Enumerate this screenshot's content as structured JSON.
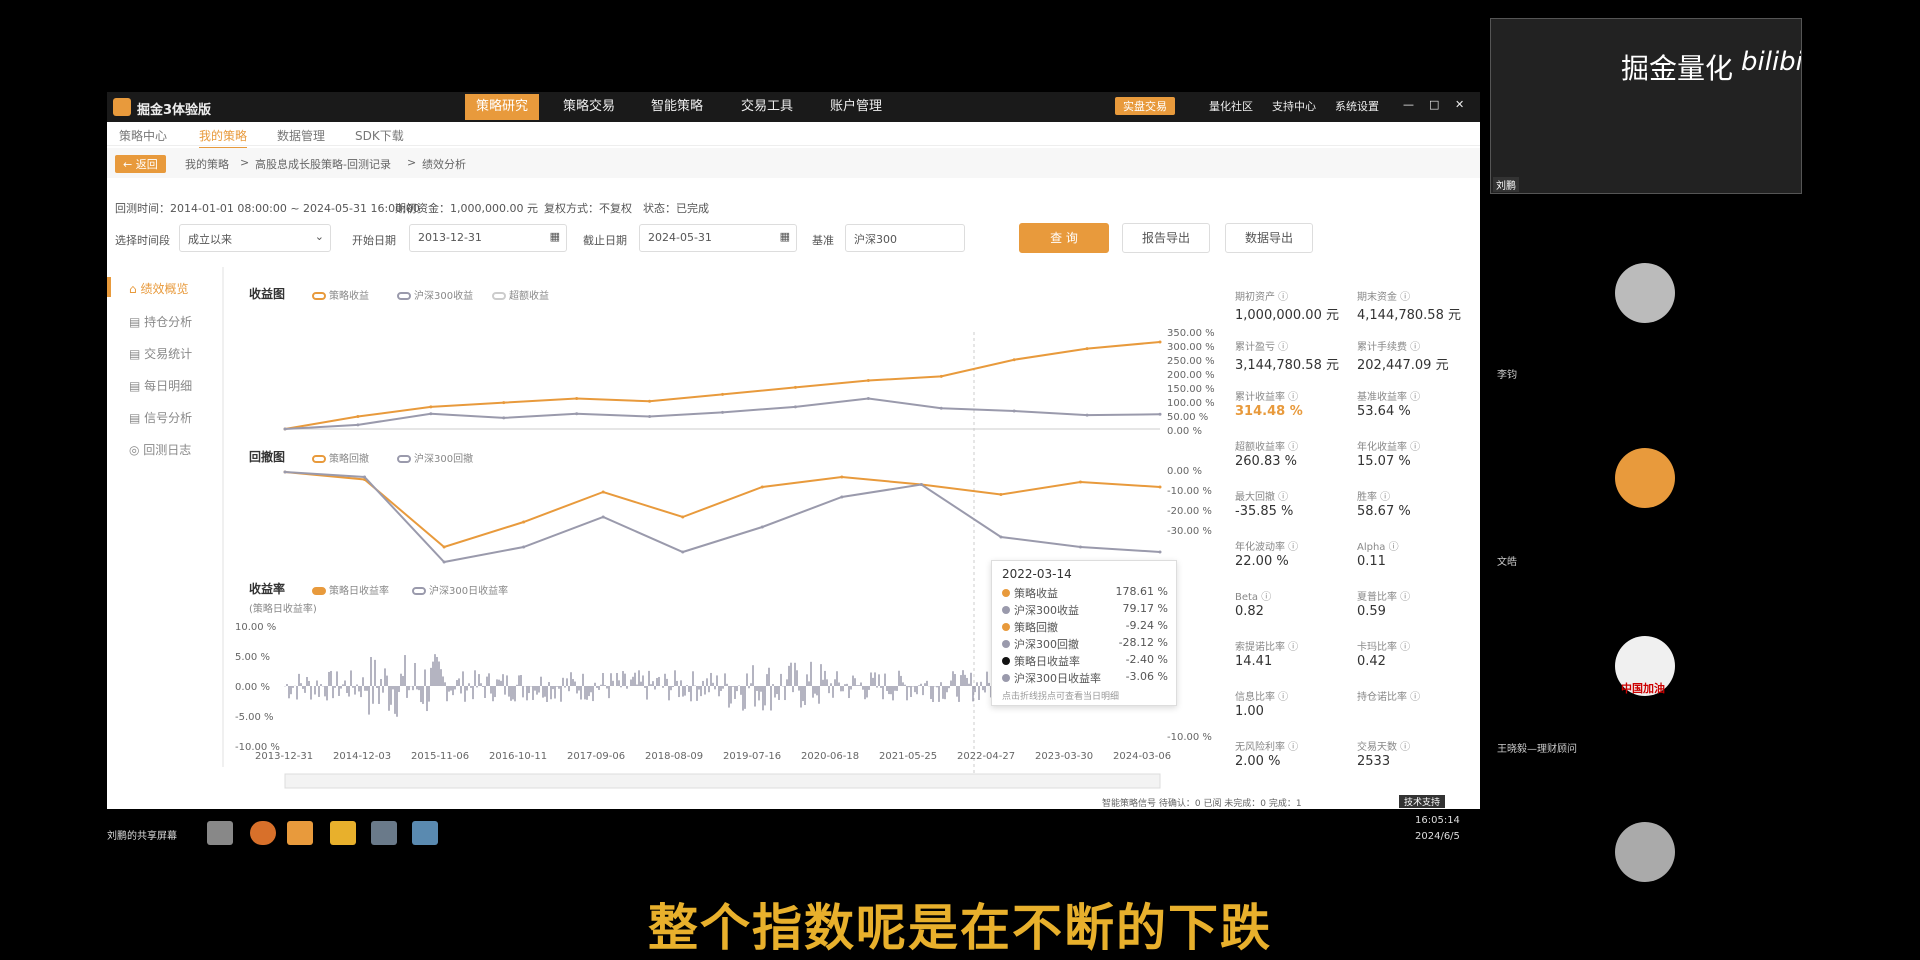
{
  "app": {
    "title": "掘金3体验版",
    "nav": [
      "策略研究",
      "策略交易",
      "智能策略",
      "交易工具",
      "账户管理"
    ],
    "nav_active_index": 0,
    "right_nav": [
      "实盘交易",
      "量化社区",
      "支持中心",
      "系统设置"
    ],
    "window_controls": [
      "—",
      "□",
      "✕"
    ]
  },
  "subnav": [
    "策略中心",
    "我的策略",
    "数据管理",
    "SDK下载"
  ],
  "breadcrumb": {
    "back": "← 返回",
    "items": [
      "我的策略",
      ">",
      "高股息成长股策略-回测记录",
      ">",
      "绩效分析"
    ]
  },
  "info": {
    "period": "回测时间：2014-01-01 08:00:00 ~ 2024-05-31 16:00:00",
    "capital": "期初资金：1,000,000.00 元",
    "adjust": "复权方式：不复权",
    "state": "状态：已完成"
  },
  "filters": {
    "range_label": "选择时间段",
    "range_value": "成立以来",
    "start_label": "开始日期",
    "start_value": "2013-12-31",
    "end_label": "截止日期",
    "end_value": "2024-05-31",
    "bench_label": "基准",
    "bench_value": "沪深300",
    "query": "查 询",
    "report": "报告导出",
    "data": "数据导出"
  },
  "sidebar": [
    "绩效概览",
    "持仓分析",
    "交易统计",
    "每日明细",
    "信号分析",
    "回测日志"
  ],
  "charts": {
    "returns_title": "收益图",
    "returns_legend": [
      "策略收益",
      "沪深300收益",
      "超额收益"
    ],
    "drawdown_title": "回撤图",
    "drawdown_legend": [
      "策略回撤",
      "沪深300回撤"
    ],
    "daily_title": "收益率",
    "daily_sub": "(策略日收益率)",
    "daily_legend": [
      "策略日收益率",
      "沪深300日收益率"
    ],
    "right_ticks_returns": [
      "350.00 %",
      "300.00 %",
      "250.00 %",
      "200.00 %",
      "150.00 %",
      "100.00 %",
      "50.00 %",
      "0.00 %"
    ],
    "right_ticks_dd": [
      "0.00 %",
      "-10.00 %",
      "-20.00 %",
      "-30.00 %"
    ],
    "right_ticks_daily": [
      "-10.00 %"
    ],
    "left_ticks_daily": [
      "10.00 %",
      "5.00 %",
      "0.00 %",
      "-5.00 %",
      "-10.00 %"
    ],
    "x_ticks": [
      "2013-12-31",
      "2014-12-03",
      "2015-11-06",
      "2016-10-11",
      "2017-09-06",
      "2018-08-09",
      "2019-07-16",
      "2020-06-18",
      "2021-05-25",
      "2022-04-27",
      "2023-03-30",
      "2024-03-06"
    ]
  },
  "chart_data": [
    {
      "type": "line",
      "title": "收益图",
      "x": [
        "2013-12-31",
        "2014-12-03",
        "2015-11-06",
        "2016-10-11",
        "2017-09-06",
        "2018-08-09",
        "2019-07-16",
        "2020-06-18",
        "2021-05-25",
        "2022-04-27",
        "2023-03-30",
        "2024-03-06",
        "2024-05-31"
      ],
      "series": [
        {
          "name": "策略收益",
          "color": "#e89a3c",
          "values": [
            0,
            45,
            80,
            95,
            110,
            100,
            125,
            150,
            175,
            190,
            250,
            290,
            314
          ]
        },
        {
          "name": "沪深300收益",
          "color": "#9a9aac",
          "values": [
            0,
            15,
            55,
            40,
            55,
            45,
            60,
            80,
            110,
            75,
            65,
            50,
            53
          ]
        }
      ],
      "ylim": [
        0,
        350
      ]
    },
    {
      "type": "line",
      "title": "回撤图",
      "x": [
        "2013-12-31",
        "2014-12-03",
        "2015-11-06",
        "2016-10-11",
        "2017-09-06",
        "2018-08-09",
        "2019-07-16",
        "2020-06-18",
        "2021-05-25",
        "2022-04-27",
        "2023-03-30",
        "2024-03-06"
      ],
      "series": [
        {
          "name": "策略回撤",
          "color": "#e89a3c",
          "values": [
            0,
            -3,
            -30,
            -20,
            -8,
            -18,
            -6,
            -2,
            -5,
            -9,
            -4,
            -6
          ]
        },
        {
          "name": "沪深300回撤",
          "color": "#9a9aac",
          "values": [
            0,
            -2,
            -36,
            -30,
            -18,
            -32,
            -22,
            -10,
            -5,
            -26,
            -30,
            -32
          ]
        }
      ],
      "ylim": [
        -36,
        0
      ]
    }
  ],
  "tooltip": {
    "date": "2022-03-14",
    "rows": [
      {
        "label": "策略收益",
        "value": "178.61 %",
        "color": "#e89a3c"
      },
      {
        "label": "沪深300收益",
        "value": "79.17 %",
        "color": "#9a9aac"
      },
      {
        "label": "策略回撤",
        "value": "-9.24 %",
        "color": "#e89a3c"
      },
      {
        "label": "沪深300回撤",
        "value": "-28.12 %",
        "color": "#9a9aac"
      },
      {
        "label": "策略日收益率",
        "value": "-2.40 %",
        "color": "#111111"
      },
      {
        "label": "沪深300日收益率",
        "value": "-3.06 %",
        "color": "#9a9aac"
      }
    ],
    "hint": "点击折线拐点可查看当日明细"
  },
  "metrics": [
    {
      "label": "期初资产",
      "value": "1,000,000.00",
      "unit": "元"
    },
    {
      "label": "期末资金",
      "value": "4,144,780.58",
      "unit": "元"
    },
    {
      "label": "累计盈亏",
      "value": "3,144,780.58",
      "unit": "元"
    },
    {
      "label": "累计手续费",
      "value": "202,447.09",
      "unit": "元"
    },
    {
      "label": "累计收益率",
      "value": "314.48",
      "unit": "%"
    },
    {
      "label": "基准收益率",
      "value": "53.64",
      "unit": "%"
    },
    {
      "label": "超额收益率",
      "value": "260.83",
      "unit": "%"
    },
    {
      "label": "年化收益率",
      "value": "15.07",
      "unit": "%"
    },
    {
      "label": "最大回撤",
      "value": "-35.85",
      "unit": "%"
    },
    {
      "label": "胜率",
      "value": "58.67",
      "unit": "%"
    },
    {
      "label": "年化波动率",
      "value": "22.00",
      "unit": "%"
    },
    {
      "label": "Alpha",
      "value": "0.11",
      "unit": ""
    },
    {
      "label": "Beta",
      "value": "0.82",
      "unit": ""
    },
    {
      "label": "夏普比率",
      "value": "0.59",
      "unit": ""
    },
    {
      "label": "索提诺比率",
      "value": "14.41",
      "unit": ""
    },
    {
      "label": "卡玛比率",
      "value": "0.42",
      "unit": ""
    },
    {
      "label": "信息比率",
      "value": "1.00",
      "unit": ""
    },
    {
      "label": "持仓诺比率",
      "value": "",
      "unit": ""
    },
    {
      "label": "无风险利率",
      "value": "2.00",
      "unit": "%"
    },
    {
      "label": "交易天数",
      "value": "2533",
      "unit": ""
    }
  ],
  "statusbar": {
    "text": "智能策略信号 待确认：0 已阅 未完成：0 完成：1",
    "support": "技术支持"
  },
  "taskbar": {
    "share_label": "刘鹏的共享屏幕",
    "time": "16:05:14",
    "date": "2024/6/5"
  },
  "video": {
    "brand": "掘金量化",
    "bili": "bilibili",
    "name": "刘鹏"
  },
  "participants": [
    "李钧",
    "文皓",
    "王晓毅—理财顾问"
  ],
  "participant_badge": "中国加油",
  "subtitle": "整个指数呢是在不断的下跌"
}
